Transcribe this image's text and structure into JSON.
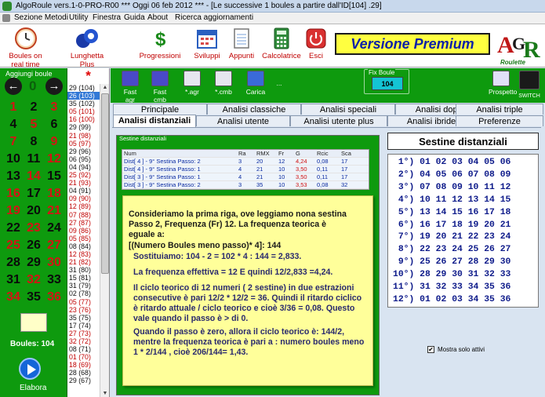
{
  "window": {
    "title": "AlgoRoule vers.1-0-PRO-R00  ***  Oggi 06 feb 2012  ***  - [Le successive 1 boules a partire dall'ID[104] .29]"
  },
  "menu": {
    "items": [
      "Sezione Metodi",
      "Utility",
      "Finestra",
      "Guida",
      "About",
      "Ricerca aggiornamenti"
    ]
  },
  "toolbar": {
    "buttons": [
      {
        "label": "Boules on real time",
        "icon": "clock-icon"
      },
      {
        "label": "Lunghetta Plus",
        "icon": "lottery-balls-icon"
      },
      {
        "label": "Progressioni",
        "icon": "dollar-icon"
      },
      {
        "label": "Sviluppi",
        "icon": "calendar-icon"
      },
      {
        "label": "Appunti",
        "icon": "notepad-icon"
      },
      {
        "label": "Calcolatrice",
        "icon": "calculator-icon"
      },
      {
        "label": "Esci",
        "icon": "power-icon"
      }
    ],
    "premium": "Versione Premium",
    "logo_text": "AGR",
    "logo_sub": "Roulette"
  },
  "left": {
    "header": "Aggiungi boule",
    "zero": "0",
    "numbers": [
      {
        "n": "1",
        "c": "r"
      },
      {
        "n": "2",
        "c": "b"
      },
      {
        "n": "3",
        "c": "r"
      },
      {
        "n": "4",
        "c": "b"
      },
      {
        "n": "5",
        "c": "r"
      },
      {
        "n": "6",
        "c": "b"
      },
      {
        "n": "7",
        "c": "r"
      },
      {
        "n": "8",
        "c": "b"
      },
      {
        "n": "9",
        "c": "r"
      },
      {
        "n": "10",
        "c": "b"
      },
      {
        "n": "11",
        "c": "b"
      },
      {
        "n": "12",
        "c": "r"
      },
      {
        "n": "13",
        "c": "b"
      },
      {
        "n": "14",
        "c": "r"
      },
      {
        "n": "15",
        "c": "b"
      },
      {
        "n": "16",
        "c": "r"
      },
      {
        "n": "17",
        "c": "b"
      },
      {
        "n": "18",
        "c": "r"
      },
      {
        "n": "19",
        "c": "r"
      },
      {
        "n": "20",
        "c": "b"
      },
      {
        "n": "21",
        "c": "r"
      },
      {
        "n": "22",
        "c": "b"
      },
      {
        "n": "23",
        "c": "r"
      },
      {
        "n": "24",
        "c": "b"
      },
      {
        "n": "25",
        "c": "r"
      },
      {
        "n": "26",
        "c": "b"
      },
      {
        "n": "27",
        "c": "r"
      },
      {
        "n": "28",
        "c": "b"
      },
      {
        "n": "29",
        "c": "b"
      },
      {
        "n": "30",
        "c": "r"
      },
      {
        "n": "31",
        "c": "b"
      },
      {
        "n": "32",
        "c": "r"
      },
      {
        "n": "33",
        "c": "b"
      },
      {
        "n": "34",
        "c": "r"
      },
      {
        "n": "35",
        "c": "b"
      },
      {
        "n": "36",
        "c": "r"
      }
    ],
    "boules": "Boules: 104",
    "elabora": "Elabora"
  },
  "history": {
    "star": "*",
    "items": [
      "29 (104)",
      "26 (103)",
      "35 (102)",
      "05 (101)",
      "16 (100)",
      "29 (99)",
      "21 (98)",
      "05 (97)",
      "29 (96)",
      "06 (95)",
      "04 (94)",
      "25 (92)",
      "21 (93)",
      "04 (91)",
      "09 (90)",
      "12 (89)",
      "07 (88)",
      "27 (87)",
      "09 (86)",
      "05 (85)",
      "08 (84)",
      "12 (83)",
      "21 (82)",
      "31 (80)",
      "15 (81)",
      "31 (79)",
      "02 (78)",
      "05 (77)",
      "23 (76)",
      "35 (75)",
      "17 (74)",
      "27 (73)",
      "32 (72)",
      "08 (71)",
      "01 (70)",
      "18 (69)",
      "28 (68)",
      "29 (67)"
    ],
    "selected": 1
  },
  "subtoolbar": {
    "buttons": [
      "Fast agr",
      "Fast cmb",
      "*.agr",
      "*.cmb",
      "Carica",
      "..."
    ],
    "fix_label": "Fix Boule",
    "fix_value": "104",
    "right": [
      "Prospetto",
      "SWITCH"
    ]
  },
  "tabs": {
    "row1": [
      "Principale",
      "Analisi classiche",
      "Analisi speciali",
      "Analisi doppie",
      "Analisi triple"
    ],
    "row2": [
      "Analisi distanziali",
      "Analisi utente",
      "Analisi utente plus",
      "Analisi ibride",
      "Preferenze"
    ],
    "active": "Analisi distanziali"
  },
  "group": {
    "label": "Sestine distanziali"
  },
  "table": {
    "headers": [
      "Num",
      "Ra",
      "RMX",
      "Fr",
      "G",
      "Rcic",
      "Sca"
    ],
    "rows": [
      [
        "Dist[ 4 ] - 9° Sestina Passo: 2",
        "3",
        "20",
        "12",
        "4,24",
        "0,08",
        "17"
      ],
      [
        "Dist[ 4 ] - 9° Sestina Passo: 1",
        "4",
        "21",
        "10",
        "3,50",
        "0,11",
        "17"
      ],
      [
        "Dist[ 3 ] - 9° Sestina Passo: 1",
        "4",
        "21",
        "10",
        "3,50",
        "0,11",
        "17"
      ],
      [
        "Dist[ 3 ] - 9° Sestina Passo: 2",
        "3",
        "35",
        "10",
        "3,53",
        "0,08",
        "32"
      ]
    ]
  },
  "note": {
    "p1": "Consideriamo la prima riga, ove leggiamo nona sestina\nPasso 2, Frequenza (Fr) 12. La frequenza teorica è\neguale a:",
    "p2": "[(Numero Boules meno passo)* 4]: 144",
    "p3": "Sostituiamo: 104 - 2 = 102 * 4 : 144 = 2,833.",
    "p4": "La frequenza effettiva = 12 E quindi 12/2,833 =4,24.",
    "p5": "Il ciclo teorico di 12 numeri ( 2 sestine)  in due estrazioni\nconsecutive è pari 12/2 * 12/2 = 36. Quindi il ritardo ciclico\nè ritardo attuale / ciclo teorico e cioè 3/36 = 0,08. Questo\nvale quando il passo è > di 0.",
    "p6": "Quando il passo è zero, allora il ciclo teorico è: 144/2,\nmentre la frequenza teorica è pari a : numero boules meno\n1 * 2/144 , cioè 206/144= 1,43."
  },
  "sestine": {
    "title": "Sestine distanziali",
    "rows": [
      " 1°) 01 02 03 04 05 06",
      " 2°) 04 05 06 07 08 09",
      " 3°) 07 08 09 10 11 12",
      " 4°) 10 11 12 13 14 15",
      " 5°) 13 14 15 16 17 18",
      " 6°) 16 17 18 19 20 21",
      " 7°) 19 20 21 22 23 24",
      " 8°) 22 23 24 25 26 27",
      " 9°) 25 26 27 28 29 30",
      "10°) 28 29 30 31 32 33",
      "11°) 31 32 33 34 35 36",
      "12°) 01 02 03 34 35 36"
    ]
  },
  "checkbox": {
    "label": "Mostra solo attivi",
    "checked": true
  }
}
